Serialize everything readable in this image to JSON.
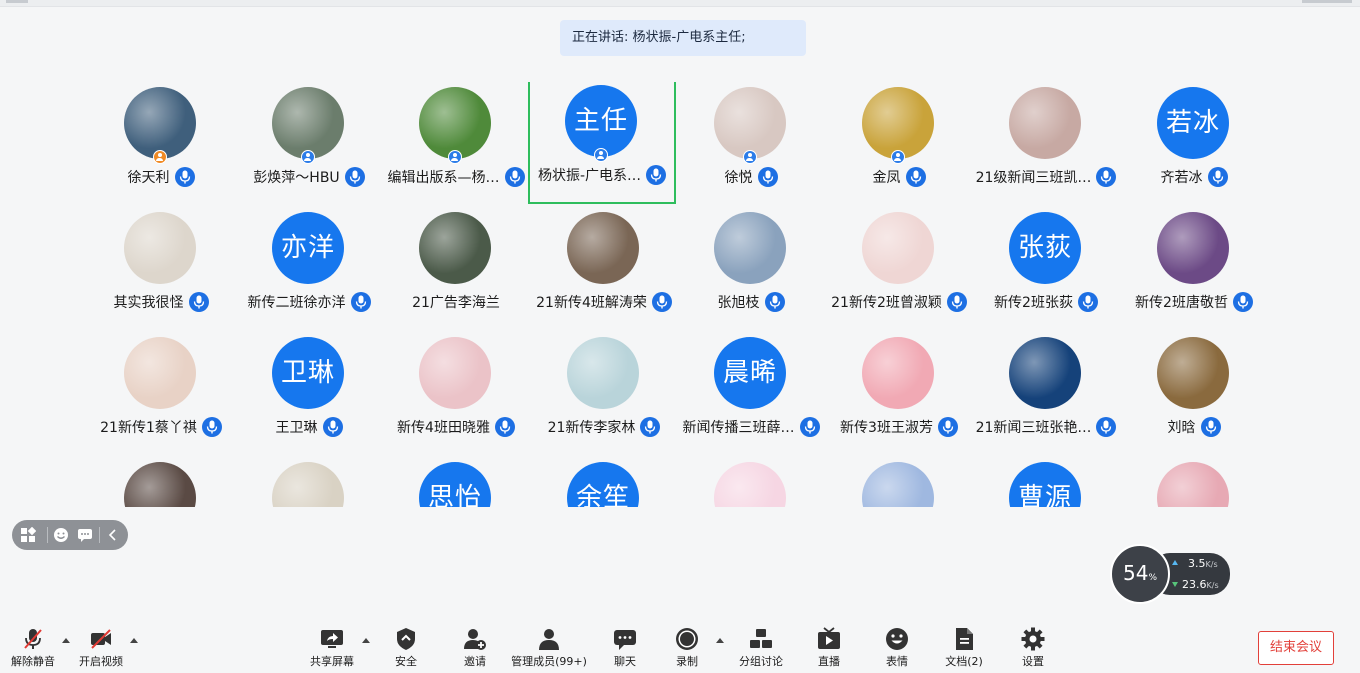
{
  "speaking_banner": {
    "text": "正在讲话: 杨状振-广电系主任;"
  },
  "participants": [
    {
      "name": "徐天利",
      "avatar_text": "",
      "avatar_bg": "#3f5f7c",
      "badge": "orange"
    },
    {
      "name": "彭焕萍～HBU",
      "avatar_text": "",
      "avatar_bg": "#6b7d6c",
      "badge": "blue"
    },
    {
      "name": "编辑出版系—杨…",
      "avatar_text": "",
      "avatar_bg": "#4f8a3a",
      "badge": "blue"
    },
    {
      "name": "杨状振-广电系…",
      "avatar_text": "主任",
      "avatar_bg": "#1677ee",
      "badge": "blue",
      "active": true
    },
    {
      "name": "徐悦",
      "avatar_text": "",
      "avatar_bg": "#d8c8c2",
      "badge": "blue"
    },
    {
      "name": "金凤",
      "avatar_text": "",
      "avatar_bg": "#c9a33a",
      "badge": "blue"
    },
    {
      "name": "21级新闻三班凯…",
      "avatar_text": "",
      "avatar_bg": "#c7a9a3",
      "badge": ""
    },
    {
      "name": "齐若冰",
      "avatar_text": "若冰",
      "avatar_bg": "#1677ee",
      "badge": ""
    },
    {
      "name": "其实我很怪",
      "avatar_text": "",
      "avatar_bg": "#ddd6cc",
      "badge": ""
    },
    {
      "name": "新传二班徐亦洋",
      "avatar_text": "亦洋",
      "avatar_bg": "#1677ee",
      "badge": ""
    },
    {
      "name": "21广告李海兰",
      "avatar_text": "",
      "avatar_bg": "#4b5a49",
      "badge": "",
      "no_mic": true
    },
    {
      "name": "21新传4班解涛荣",
      "avatar_text": "",
      "avatar_bg": "#7a6655",
      "badge": ""
    },
    {
      "name": "张旭枝",
      "avatar_text": "",
      "avatar_bg": "#8aa2bd",
      "badge": ""
    },
    {
      "name": "21新传2班曾淑颖",
      "avatar_text": "",
      "avatar_bg": "#efd6d4",
      "badge": ""
    },
    {
      "name": "新传2班张荻",
      "avatar_text": "张荻",
      "avatar_bg": "#1677ee",
      "badge": ""
    },
    {
      "name": "新传2班唐敬哲",
      "avatar_text": "",
      "avatar_bg": "#6c4a86",
      "badge": ""
    },
    {
      "name": "21新传1蔡丫祺",
      "avatar_text": "",
      "avatar_bg": "#e8d2c6",
      "badge": ""
    },
    {
      "name": "王卫琳",
      "avatar_text": "卫琳",
      "avatar_bg": "#1677ee",
      "badge": ""
    },
    {
      "name": "新传4班田晓雅",
      "avatar_text": "",
      "avatar_bg": "#ebc3c8",
      "badge": ""
    },
    {
      "name": "21新传李家林",
      "avatar_text": "",
      "avatar_bg": "#b9d4da",
      "badge": ""
    },
    {
      "name": "新闻传播三班薛…",
      "avatar_text": "晨晞",
      "avatar_bg": "#1677ee",
      "badge": ""
    },
    {
      "name": "新传3班王淑芳",
      "avatar_text": "",
      "avatar_bg": "#f1a9b4",
      "badge": ""
    },
    {
      "name": "21新闻三班张艳…",
      "avatar_text": "",
      "avatar_bg": "#15427a",
      "badge": ""
    },
    {
      "name": "刘晗",
      "avatar_text": "",
      "avatar_bg": "#8a6a3e",
      "badge": ""
    },
    {
      "name": "",
      "avatar_text": "",
      "avatar_bg": "#5a4a44",
      "badge": ""
    },
    {
      "name": "",
      "avatar_text": "",
      "avatar_bg": "#d9d2c4",
      "badge": ""
    },
    {
      "name": "",
      "avatar_text": "思怡",
      "avatar_bg": "#1677ee",
      "badge": ""
    },
    {
      "name": "",
      "avatar_text": "余笙",
      "avatar_bg": "#1677ee",
      "badge": ""
    },
    {
      "name": "",
      "avatar_text": "",
      "avatar_bg": "#f6d6e3",
      "badge": ""
    },
    {
      "name": "",
      "avatar_text": "",
      "avatar_bg": "#9fb8e0",
      "badge": ""
    },
    {
      "name": "",
      "avatar_text": "曹源",
      "avatar_bg": "#1677ee",
      "badge": ""
    },
    {
      "name": "",
      "avatar_text": "",
      "avatar_bg": "#e7a9b4",
      "badge": ""
    }
  ],
  "network": {
    "percent": "54",
    "percent_unit": "%",
    "upload": "3.5",
    "upload_unit": "K/s",
    "download": "23.6",
    "download_unit": "K/s"
  },
  "toolbar": {
    "unmute": "解除静音",
    "start_video": "开启视频",
    "share_screen": "共享屏幕",
    "security": "安全",
    "invite": "邀请",
    "manage_members": "管理成员(99+)",
    "chat": "聊天",
    "record": "录制",
    "breakout": "分组讨论",
    "live": "直播",
    "reactions": "表情",
    "docs": "文档(2)",
    "settings": "设置",
    "end_meeting": "结束会议"
  }
}
